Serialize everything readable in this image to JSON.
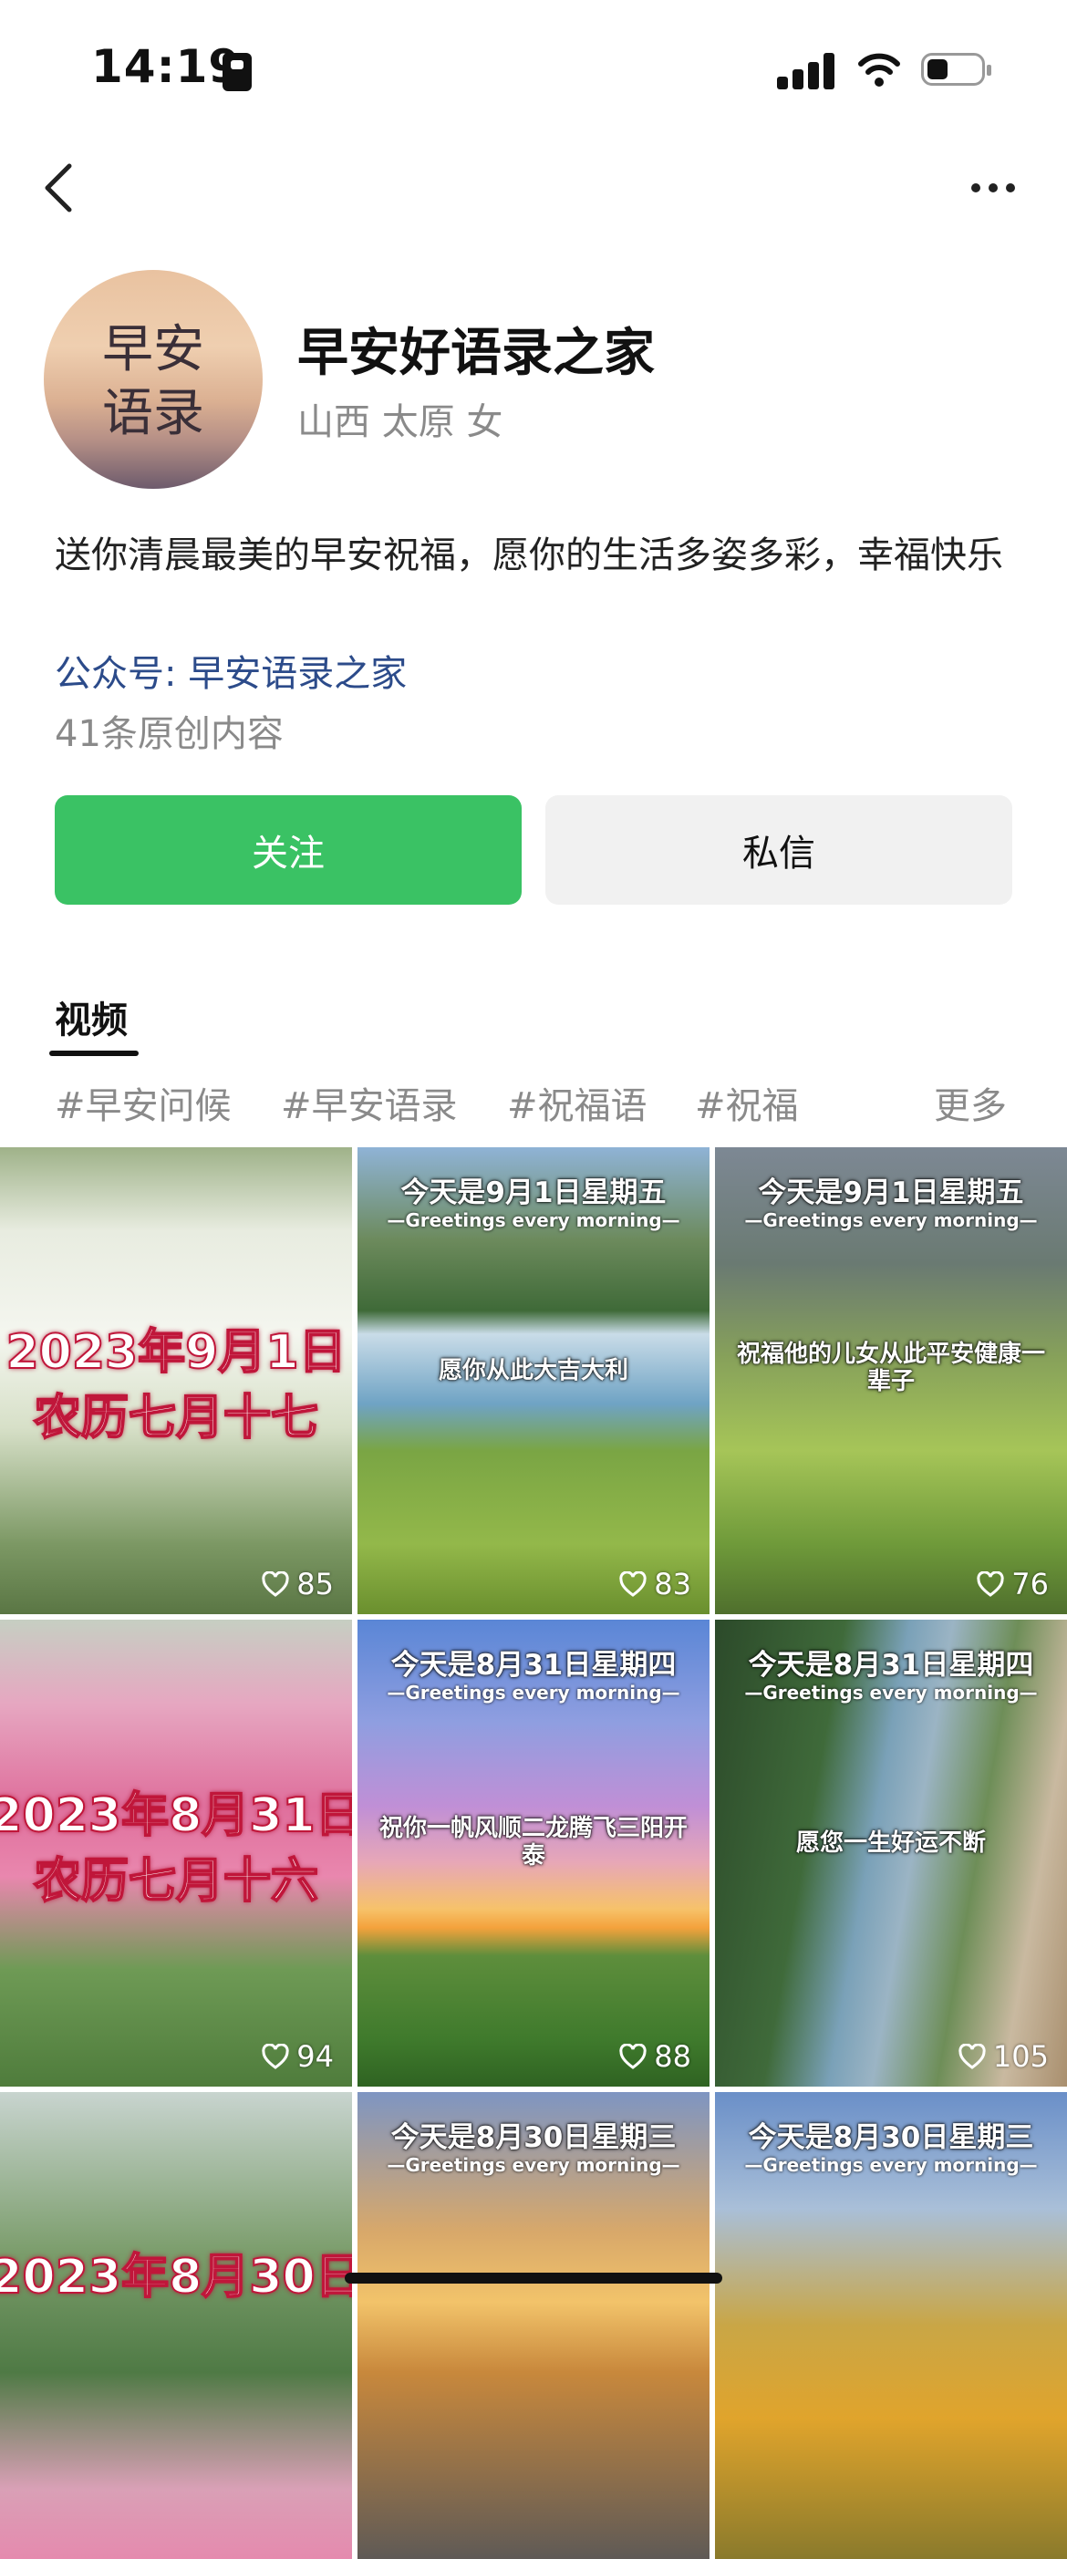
{
  "status_bar": {
    "time": "14:19"
  },
  "profile": {
    "avatar_text_line1": "早安",
    "avatar_text_line2": "语录",
    "name": "早安好语录之家",
    "location": "山西 太原 女",
    "bio": " 送你清晨最美的早安祝福，愿你的生活多姿多彩，幸福快乐",
    "official_account": "公众号: 早安语录之家",
    "original_count": "41条原创内容"
  },
  "actions": {
    "follow": "关注",
    "message": "私信"
  },
  "tabs": {
    "videos": "视频"
  },
  "tags": [
    "#早安问候",
    "#早安语录",
    "#祝福语",
    "#祝福"
  ],
  "tags_more": "更多",
  "videos": [
    {
      "big_line1": "2023年9月1日",
      "big_line2": "农历七月十七",
      "likes": "85"
    },
    {
      "title": "今天是9月1日星期五",
      "subtitle": "—Greetings every morning—",
      "caption": "愿你从此大吉大利",
      "likes": "83"
    },
    {
      "title": "今天是9月1日星期五",
      "subtitle": "—Greetings every morning—",
      "caption": "祝福他的儿女从此平安健康一辈子",
      "likes": "76"
    },
    {
      "big_line1": "2023年8月31日",
      "big_line2": "农历七月十六",
      "likes": "94"
    },
    {
      "title": "今天是8月31日星期四",
      "subtitle": "—Greetings every morning—",
      "caption": "祝你一帆风顺二龙腾飞三阳开泰",
      "likes": "88"
    },
    {
      "title": "今天是8月31日星期四",
      "subtitle": "—Greetings every morning—",
      "caption": "愿您一生好运不断",
      "likes": "105"
    },
    {
      "big_line1": "2023年8月30日",
      "likes": ""
    },
    {
      "title": "今天是8月30日星期三",
      "subtitle": "—Greetings every morning—",
      "likes": ""
    },
    {
      "title": "今天是8月30日星期三",
      "subtitle": "—Greetings every morning—",
      "likes": ""
    }
  ]
}
